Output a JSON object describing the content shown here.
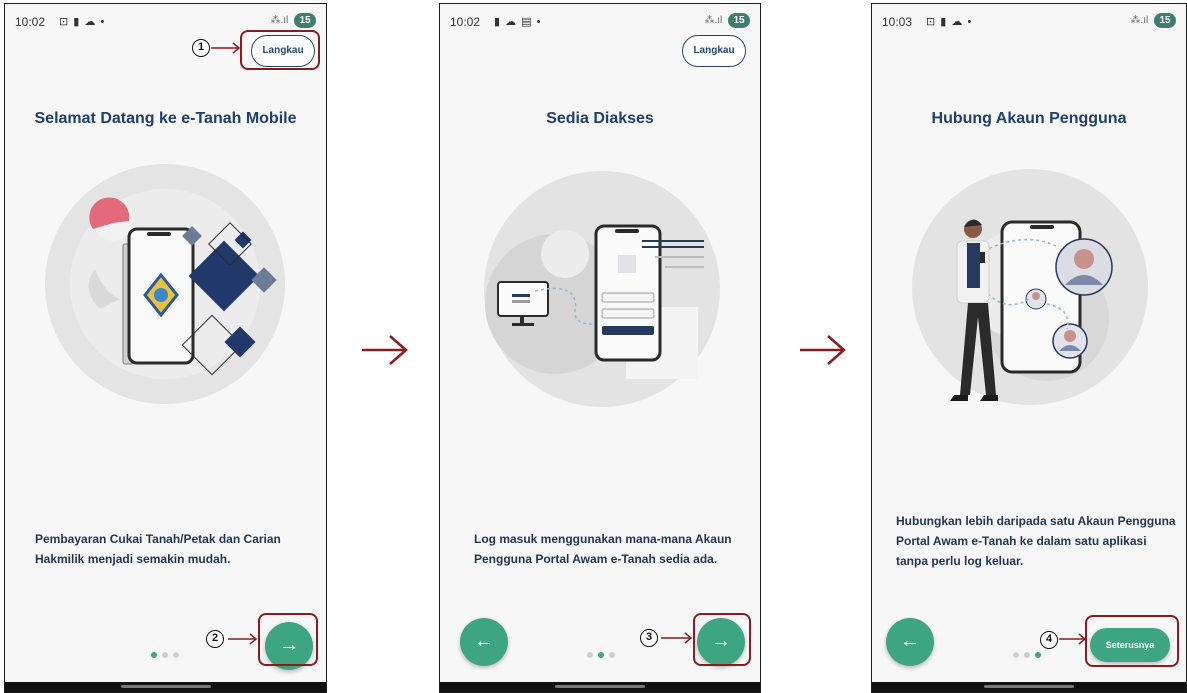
{
  "screens": [
    {
      "time": "10:02",
      "status_icons": "⊡ ▮ ☁ •",
      "battery": "15",
      "skip_label": "Langkau",
      "title": "Selamat Datang ke e-Tanah Mobile",
      "description": "Pembayaran Cukai Tanah/Petak dan Carian Hakmilik menjadi semakin mudah.",
      "next_icon": "→",
      "active_dot": 1
    },
    {
      "time": "10:02",
      "status_icons": "▮ ☁ ▤ •",
      "battery": "15",
      "skip_label": "Langkau",
      "title": "Sedia Diakses",
      "description": "Log masuk menggunakan mana-mana Akaun Pengguna Portal Awam e-Tanah sedia ada.",
      "back_icon": "←",
      "next_icon": "→",
      "active_dot": 2
    },
    {
      "time": "10:03",
      "status_icons": "⊡ ▮ ☁ •",
      "battery": "15",
      "title": "Hubung Akaun Pengguna",
      "description": "Hubungkan lebih daripada satu Akaun Pengguna Portal Awam e-Tanah ke dalam satu aplikasi tanpa perlu log keluar.",
      "back_icon": "←",
      "cta_label": "Seterusnya",
      "active_dot": 3
    }
  ],
  "signal_text": "⁂.ıl",
  "annotations": {
    "markers": [
      "1",
      "2",
      "3",
      "4"
    ],
    "flow_arrow_glyph": "→"
  },
  "colors": {
    "primary_green": "#3ea583",
    "title_navy": "#203f6b",
    "callout_red": "#8b1c1c"
  }
}
